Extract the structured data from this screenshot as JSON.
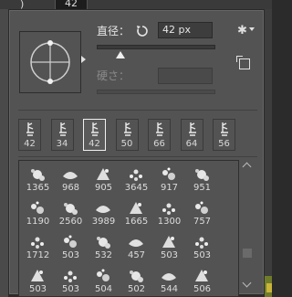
{
  "host": {
    "tab_mark": ")",
    "tab_number": "42"
  },
  "panel": {
    "size_label": "直径：",
    "size_value": "42 px",
    "size_fraction": 0.2,
    "hardness_label": "硬さ：",
    "hardness_value": ""
  },
  "recent_brushes": [
    {
      "size": "42"
    },
    {
      "size": "34"
    },
    {
      "size": "42",
      "selected": true
    },
    {
      "size": "50"
    },
    {
      "size": "66"
    },
    {
      "size": "64"
    },
    {
      "size": "56"
    }
  ],
  "preset_rows": [
    [
      "1365",
      "968",
      "905",
      "3645",
      "917",
      "951"
    ],
    [
      "1190",
      "2560",
      "3989",
      "1665",
      "1300",
      "757"
    ],
    [
      "1712",
      "503",
      "532",
      "457",
      "503",
      "503"
    ],
    [
      "503",
      "503",
      "504",
      "502",
      "544",
      "506"
    ]
  ],
  "colors": {
    "panel": "#535353",
    "accent_selected": "#f0f0f0",
    "background": "#2b2b2b"
  }
}
